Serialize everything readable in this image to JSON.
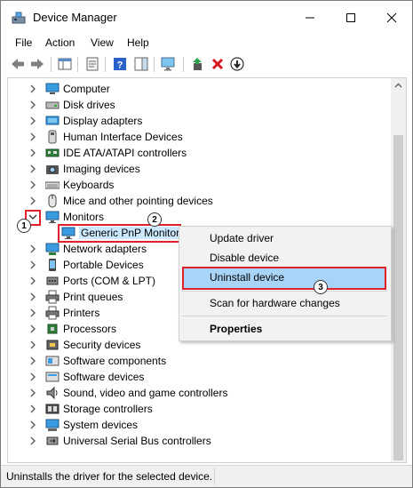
{
  "window": {
    "title": "Device Manager"
  },
  "menu": [
    "File",
    "Action",
    "View",
    "Help"
  ],
  "tree": {
    "categories": [
      {
        "label": "Computer",
        "icon": "computer-icon"
      },
      {
        "label": "Disk drives",
        "icon": "disk-drive-icon"
      },
      {
        "label": "Display adapters",
        "icon": "display-adapter-icon"
      },
      {
        "label": "Human Interface Devices",
        "icon": "hid-icon"
      },
      {
        "label": "IDE ATA/ATAPI controllers",
        "icon": "ide-controller-icon"
      },
      {
        "label": "Imaging devices",
        "icon": "camera-icon"
      },
      {
        "label": "Keyboards",
        "icon": "keyboard-icon"
      },
      {
        "label": "Mice and other pointing devices",
        "icon": "mouse-icon"
      },
      {
        "label": "Monitors",
        "icon": "monitor-icon",
        "expanded": true
      },
      {
        "label": "Network adapters",
        "icon": "network-adapter-icon"
      },
      {
        "label": "Portable Devices",
        "icon": "portable-device-icon"
      },
      {
        "label": "Ports (COM & LPT)",
        "icon": "port-icon"
      },
      {
        "label": "Print queues",
        "icon": "printer-icon"
      },
      {
        "label": "Printers",
        "icon": "printer-icon"
      },
      {
        "label": "Processors",
        "icon": "processor-icon"
      },
      {
        "label": "Security devices",
        "icon": "security-device-icon"
      },
      {
        "label": "Software components",
        "icon": "software-component-icon"
      },
      {
        "label": "Software devices",
        "icon": "software-device-icon"
      },
      {
        "label": "Sound, video and game controllers",
        "icon": "sound-icon"
      },
      {
        "label": "Storage controllers",
        "icon": "storage-controller-icon"
      },
      {
        "label": "System devices",
        "icon": "system-device-icon"
      },
      {
        "label": "Universal Serial Bus controllers",
        "icon": "usb-icon"
      }
    ],
    "monitor_child": "Generic PnP Monitor"
  },
  "context_menu": {
    "items": [
      "Update driver",
      "Disable device",
      "Uninstall device",
      "Scan for hardware changes",
      "Properties"
    ]
  },
  "annotations": {
    "step1": "1",
    "step2": "2",
    "step3": "3"
  },
  "status": {
    "text": "Uninstalls the driver for the selected device."
  },
  "colors": {
    "highlight_border": "#e0202a",
    "menu_highlight": "#a8d4f7",
    "selection": "#cce8ff"
  }
}
